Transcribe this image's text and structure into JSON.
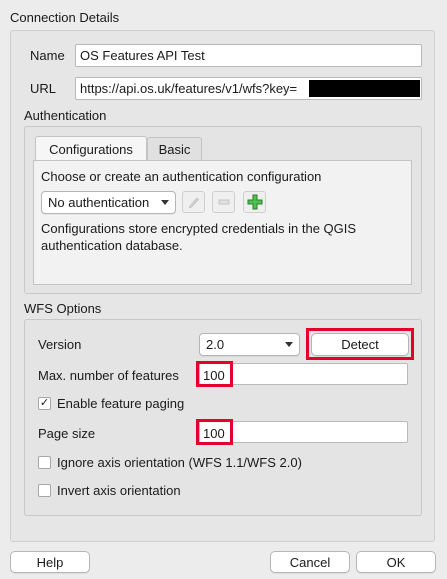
{
  "connection": {
    "title": "Connection Details",
    "name_label": "Name",
    "name_value": "OS Features API Test",
    "url_label": "URL",
    "url_value": "https://api.os.uk/features/v1/wfs?key="
  },
  "authentication": {
    "title": "Authentication",
    "tabs": [
      {
        "label": "Configurations",
        "active": true
      },
      {
        "label": "Basic",
        "active": false
      }
    ],
    "prompt": "Choose or create an authentication configuration",
    "config_select": "No authentication",
    "info": "Configurations store encrypted credentials in the QGIS authentication database."
  },
  "wfs": {
    "title": "WFS Options",
    "version_label": "Version",
    "version_value": "2.0",
    "detect_label": "Detect",
    "max_features_label": "Max. number of features",
    "max_features_value": "100",
    "feature_paging_label": "Enable feature paging",
    "feature_paging_checked": true,
    "page_size_label": "Page size",
    "page_size_value": "100",
    "ignore_axis_label": "Ignore axis orientation (WFS 1.1/WFS 2.0)",
    "ignore_axis_checked": false,
    "invert_axis_label": "Invert axis orientation",
    "invert_axis_checked": false
  },
  "footer": {
    "help_label": "Help",
    "cancel_label": "Cancel",
    "ok_label": "OK"
  },
  "colors": {
    "highlight": "#e4002b",
    "add_icon": "#3aa33a"
  }
}
